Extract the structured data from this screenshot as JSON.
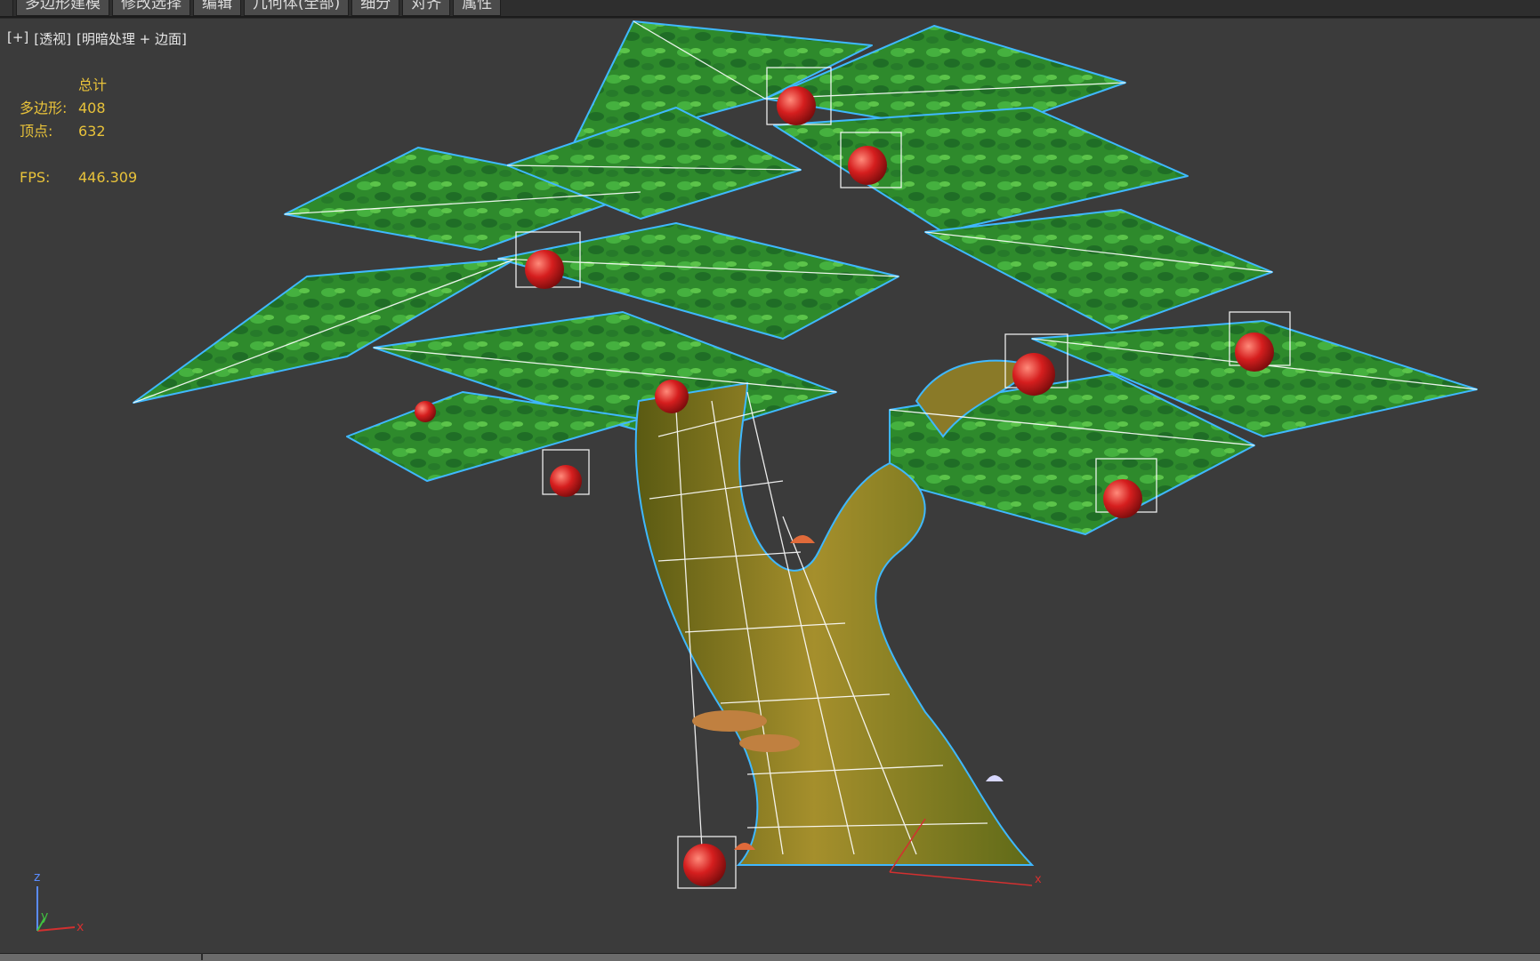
{
  "ribbon": {
    "tabs": [
      "多边形建模",
      "修改选择",
      "编辑",
      "几何体(全部)",
      "细分",
      "对齐",
      "属性"
    ]
  },
  "viewport": {
    "label": {
      "plus": "[+]",
      "view": "[透视]",
      "shading": "[明暗处理 + 边面]"
    },
    "stats": {
      "header": "总计",
      "polygons_label": "多边形:",
      "polygons_value": "408",
      "vertices_label": "顶点:",
      "vertices_value": "632",
      "fps_label": "FPS:",
      "fps_value": "446.309"
    },
    "gizmo": {
      "z": "z",
      "y": "y",
      "x": "x"
    },
    "scene_object": "tree-model",
    "colors": {
      "background": "#3b3b3b",
      "selection_outline": "#3fb8ff",
      "wire": "#ffffff",
      "stats_text": "#e8c23a",
      "leaf": "#2f8a2a",
      "trunk": "#8c7a25",
      "apple": "#d21e1e"
    }
  }
}
